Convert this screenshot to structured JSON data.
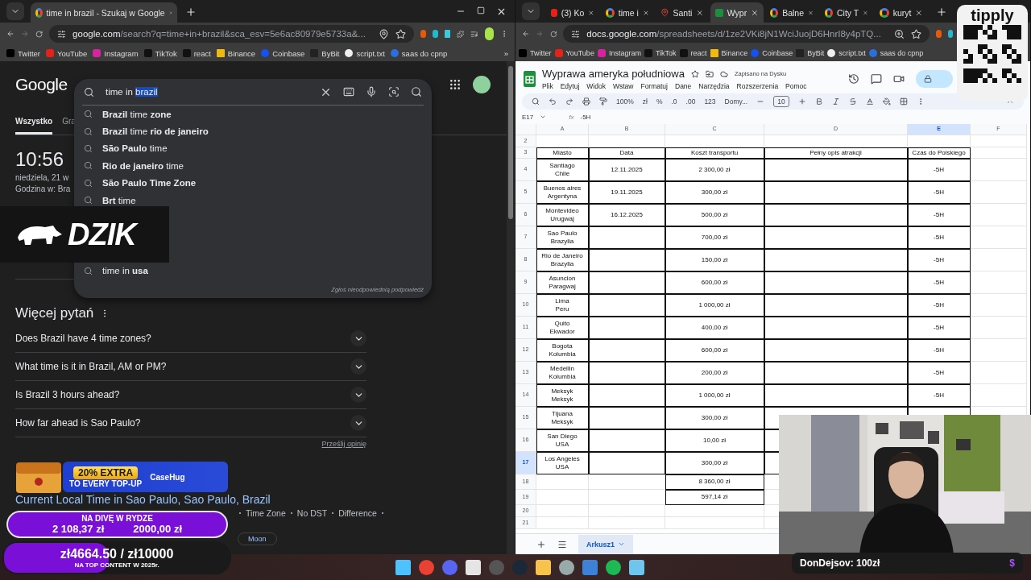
{
  "left_window": {
    "tabs": [
      {
        "title": "time in brazil - Szukaj w Google",
        "selected": true
      }
    ],
    "url": {
      "host": "google.com",
      "rest": "/search?q=time+in+brazil&sca_esv=5e6ac80979e5733a&..."
    },
    "bookmarks": [
      "Twitter",
      "YouTube",
      "Instagram",
      "TikTok",
      "react",
      "Binance",
      "Coinbase",
      "ByBit",
      "script.txt",
      "saas do cpnp"
    ],
    "bookmarks_more": "»",
    "google": {
      "logo": "Google",
      "search": {
        "text": "time in ",
        "selected_text": "brazil"
      },
      "suggestions": [
        "**Brazil** time **zone**",
        "**Brazil** time **rio de janeiro**",
        "**São Paulo** time",
        "**Rio de janeiro** time",
        "**São Paulo Time Zone**",
        "**Brt** time",
        "time in **usa**"
      ],
      "report": "Zgłoś nieodpowiednią podpowiedź",
      "tabs": [
        {
          "label": "Wszystko",
          "selected": true
        },
        {
          "label": "Gra",
          "selected": false
        }
      ],
      "clock": {
        "time": "10:56",
        "date": "niedziela, 21 w",
        "zone": "Godzina w: Bra"
      },
      "more_questions": {
        "title": "Więcej pytań",
        "questions": [
          "Does Brazil have 4 time zones?",
          "What time is it in Brazil, AM or PM?",
          "Is Brazil 3 hours ahead?",
          "How far ahead is Sao Paulo?"
        ],
        "feedback": "Prześlij opinię"
      },
      "result": {
        "title": "Current Local Time in Sao Paulo, Sao Paulo, Brazil",
        "links": [
          "Time Zone",
          "No DST",
          "Difference"
        ],
        "chips": [
          "Moon"
        ]
      }
    }
  },
  "right_window": {
    "tabs": [
      {
        "title": "(3) Ko",
        "selected": false
      },
      {
        "title": "time i",
        "selected": false
      },
      {
        "title": "Santi",
        "selected": false
      },
      {
        "title": "Wypr",
        "selected": true
      },
      {
        "title": "Balne",
        "selected": false
      },
      {
        "title": "City T",
        "selected": false
      },
      {
        "title": "kuryt",
        "selected": false
      }
    ],
    "url": {
      "host": "docs.google.com",
      "rest": "/spreadsheets/d/1ze2VKi8jN1WciJuojD6HnrI8y4pTQ..."
    },
    "bookmarks": [
      "Twitter",
      "YouTube",
      "Instagram",
      "TikTok",
      "react",
      "Binance",
      "Coinbase",
      "ByBit",
      "script.txt",
      "saas do cpnp"
    ],
    "sheet": {
      "title": "Wyprawa ameryka południowa",
      "saved": "Zapisano na Dysku",
      "menu": [
        "Plik",
        "Edytuj",
        "Widok",
        "Wstaw",
        "Formatuj",
        "Dane",
        "Narzędzia",
        "Rozszerzenia",
        "Pomoc"
      ],
      "toolbar": {
        "zoom": "100%",
        "currency": "zł",
        "percent": "%",
        "decrease_decimals": ".0",
        "increase_decimals": ".00",
        "number_format": "123",
        "font": "Domy...",
        "font_size": "10"
      },
      "formula": {
        "cell": "E17",
        "fx": "fx",
        "value": "-5H"
      },
      "columns": [
        {
          "label": "A",
          "selected": false
        },
        {
          "label": "B",
          "selected": false
        },
        {
          "label": "C",
          "selected": false
        },
        {
          "label": "D",
          "selected": false
        },
        {
          "label": "E",
          "selected": true
        },
        {
          "label": "F",
          "selected": false
        }
      ],
      "rows": [
        {
          "number": "2",
          "kind": "blank",
          "selected": false
        },
        {
          "number": "3",
          "kind": "header",
          "selected": false,
          "cells": [
            "Miasto",
            "Data",
            "Koszt transportu",
            "Pełny opis atrakcji",
            "Czas do Polskiego"
          ]
        },
        {
          "number": "4",
          "kind": "data",
          "selected": false,
          "place": "Santiago\nChile",
          "date": "12.11.2025",
          "cost": "2 300,00 zł",
          "offset": "-5H"
        },
        {
          "number": "5",
          "kind": "data",
          "selected": false,
          "place": "Buenos aires\nArgentyna",
          "date": "19.11.2025",
          "cost": "300,00 zł",
          "offset": "-5H"
        },
        {
          "number": "6",
          "kind": "data",
          "selected": false,
          "place": "Montevideo\nUrugwaj",
          "date": "16.12.2025",
          "cost": "500,00 zł",
          "offset": "-5H"
        },
        {
          "number": "7",
          "kind": "data",
          "selected": false,
          "place": "Sao Paulo\nBrazylia",
          "cost": "700,00 zł",
          "offset": "-5H"
        },
        {
          "number": "8",
          "kind": "data",
          "selected": false,
          "place": "Rio de Janeiro\nBrazylia",
          "cost": "150,00 zł",
          "offset": "-5H"
        },
        {
          "number": "9",
          "kind": "data",
          "selected": false,
          "place": "Asuncion\nParagwaj",
          "cost": "600,00 zł",
          "offset": "-5H"
        },
        {
          "number": "10",
          "kind": "data",
          "selected": false,
          "place": "Lima\nPeru",
          "cost": "1 000,00 zł",
          "offset": "-5H"
        },
        {
          "number": "11",
          "kind": "data",
          "selected": false,
          "place": "Quito\nEkwador",
          "cost": "400,00 zł",
          "offset": "-5H"
        },
        {
          "number": "12",
          "kind": "data",
          "selected": false,
          "place": "Bogota\nKolumbia",
          "cost": "600,00 zł",
          "offset": "-5H"
        },
        {
          "number": "13",
          "kind": "data",
          "selected": false,
          "place": "Medellin\nKolumbia",
          "cost": "200,00 zł",
          "offset": "-5H"
        },
        {
          "number": "14",
          "kind": "data",
          "selected": false,
          "place": "Meksyk\nMeksyk",
          "cost": "1 000,00 zł",
          "offset": "-5H"
        },
        {
          "number": "15",
          "kind": "data",
          "selected": false,
          "place": "Tijuana\nMeksyk",
          "cost": "300,00 zł"
        },
        {
          "number": "16",
          "kind": "data",
          "selected": false,
          "place": "San Diego\nUSA",
          "cost": "10,00 zł"
        },
        {
          "number": "17",
          "kind": "data",
          "selected": true,
          "place": "Los Angeles\nUSA",
          "cost": "300,00 zł"
        },
        {
          "number": "18",
          "kind": "total",
          "selected": false,
          "cost": "8 360,00 zł"
        },
        {
          "number": "19",
          "kind": "total",
          "selected": false,
          "cost": "597,14 zł"
        },
        {
          "number": "20",
          "kind": "blank",
          "selected": false
        },
        {
          "number": "21",
          "kind": "blank",
          "selected": false
        }
      ],
      "sheet_tabs": [
        {
          "label": "Arkusz1",
          "selected": true
        }
      ]
    }
  },
  "overlays": {
    "logo": "DZIK",
    "tipply": "tipply",
    "ad": {
      "headline": "20% EXTRA",
      "subline": "TO EVERY TOP-UP",
      "brand": "CaseHug"
    },
    "goals": [
      {
        "title": "NA DIVĘ W RYDZE",
        "current": "2 108,37 zł",
        "target": "2000,00 zł",
        "level": 1
      },
      {
        "amount": "zł4664.50 / zł10000",
        "title": "NA TOP CONTENT W 2025r.",
        "level": 0.466
      }
    ],
    "donation": {
      "text": "DonDejsov: 100zł",
      "symbol": "$"
    }
  }
}
